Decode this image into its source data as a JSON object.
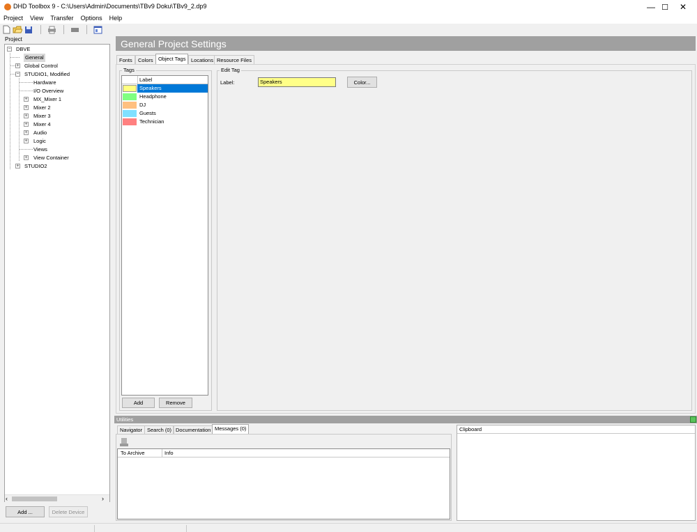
{
  "window": {
    "title": "DHD Toolbox 9 - C:\\Users\\Admin\\Documents\\TBv9 Doku\\TBv9_2.dp9",
    "minimize": "—",
    "maximize": "☐",
    "close": "✕"
  },
  "menu": [
    "Project",
    "View",
    "Transfer",
    "Options",
    "Help"
  ],
  "toolbar": {
    "icons": [
      "new-file-icon",
      "open-folder-icon",
      "save-icon",
      "print-icon",
      "device-icon",
      "settings-window-icon"
    ]
  },
  "project_panel": {
    "label": "Project",
    "tree": [
      {
        "label": "DBVE",
        "depth": 0,
        "expander": "−"
      },
      {
        "label": "General",
        "depth": 1,
        "expander": "",
        "selected": true
      },
      {
        "label": "Global Control",
        "depth": 1,
        "expander": "+"
      },
      {
        "label": "STUDIO1, Modified",
        "depth": 1,
        "expander": "−"
      },
      {
        "label": "Hardware",
        "depth": 2,
        "expander": ""
      },
      {
        "label": "I/O Overview",
        "depth": 2,
        "expander": ""
      },
      {
        "label": "MX_Mixer 1",
        "depth": 2,
        "expander": "+"
      },
      {
        "label": "Mixer 2",
        "depth": 2,
        "expander": "+"
      },
      {
        "label": "Mixer 3",
        "depth": 2,
        "expander": "+"
      },
      {
        "label": "Mixer 4",
        "depth": 2,
        "expander": "+"
      },
      {
        "label": "Audio",
        "depth": 2,
        "expander": "+"
      },
      {
        "label": "Logic",
        "depth": 2,
        "expander": "+"
      },
      {
        "label": "Views",
        "depth": 2,
        "expander": ""
      },
      {
        "label": "View Container",
        "depth": 2,
        "expander": "+"
      },
      {
        "label": "STUDIO2",
        "depth": 1,
        "expander": "+"
      }
    ],
    "scroll_left": "‹",
    "scroll_right": "›",
    "add_button": "Add ...",
    "delete_button": "Delete Device"
  },
  "main": {
    "header": "General Project Settings",
    "tabs": [
      "Fonts",
      "Colors",
      "Object Tags",
      "Locations",
      "Resource Files"
    ],
    "active_tab": "Object Tags",
    "tags_group": {
      "title": "Tags",
      "column_label": "Label",
      "items": [
        {
          "label": "Speakers",
          "color": "#ffff80",
          "selected": true
        },
        {
          "label": "Headphone",
          "color": "#80ff80"
        },
        {
          "label": "DJ",
          "color": "#ffc080"
        },
        {
          "label": "Guests",
          "color": "#80e0ff"
        },
        {
          "label": "Technician",
          "color": "#ff8080"
        }
      ],
      "add_button": "Add",
      "remove_button": "Remove"
    },
    "edit_tag": {
      "title": "Edit Tag",
      "label_caption": "Label:",
      "label_value": "Speakers",
      "color_button": "Color..."
    }
  },
  "utilities": {
    "title": "Utilities",
    "tabs": [
      "Navigator",
      "Search (0)",
      "Documentation",
      "Messages (0)"
    ],
    "active_tab": "Messages (0)",
    "columns": [
      "To Archive",
      "Info"
    ],
    "clipboard_title": "Clipboard"
  }
}
